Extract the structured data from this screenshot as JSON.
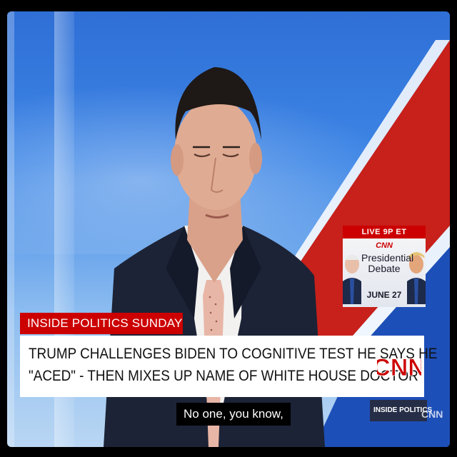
{
  "promo": {
    "live_label": "LIVE 9P ET",
    "network": "CNN",
    "title_line1": "Presidential",
    "title_line2": "Debate",
    "date": "JUNE 27"
  },
  "lower_third": {
    "show_name": "INSIDE POLITICS SUNDAY",
    "headline_line1": "TRUMP CHALLENGES BIDEN TO COGNITIVE TEST HE SAYS HE",
    "headline_line2": "\"ACED\" - THEN MIXES UP NAME OF WHITE HOUSE DOCTOR",
    "logo_text": "CNN"
  },
  "caption": {
    "text": "No one, you know,"
  },
  "bug": {
    "show": "INSIDE POLITICS",
    "network": "CNN"
  },
  "colors": {
    "cnn_red": "#cc0000",
    "background_blue": "#3d86e6",
    "suit": "#1c2336"
  }
}
